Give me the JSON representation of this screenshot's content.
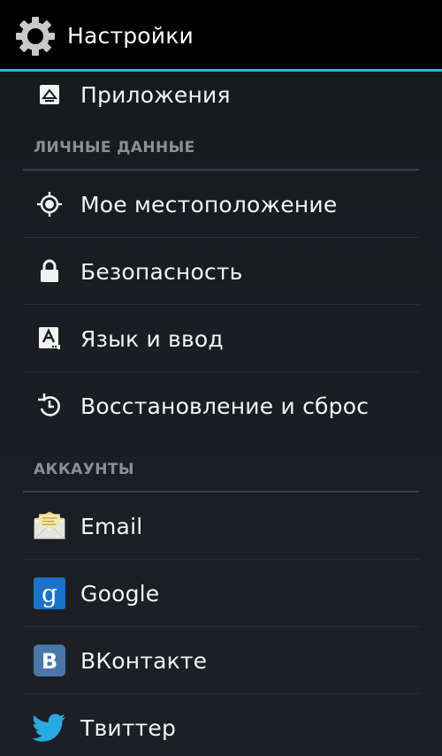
{
  "action_bar": {
    "title": "Настройки",
    "icon": "gear-icon",
    "divider_color": "#33b5e5"
  },
  "list": {
    "apps_item": {
      "label": "Приложения",
      "icon": "apps-icon"
    },
    "personal_header": "ЛИЧНЫЕ ДАННЫЕ",
    "personal_items": [
      {
        "label": "Мое местоположение",
        "icon": "location-icon"
      },
      {
        "label": "Безопасность",
        "icon": "lock-icon"
      },
      {
        "label": "Язык и ввод",
        "icon": "keyboard-language-icon"
      },
      {
        "label": "Восстановление и сброс",
        "icon": "backup-restore-icon"
      }
    ],
    "accounts_header": "АККАУНТЫ",
    "accounts_items": [
      {
        "label": "Email",
        "icon": "email-envelope-icon",
        "color": "#e9d27a"
      },
      {
        "label": "Google",
        "icon": "google-g-icon",
        "color": "#1a73c9"
      },
      {
        "label": "ВКонтакте",
        "icon": "vk-icon",
        "color": "#4a76a8"
      },
      {
        "label": "Твиттер",
        "icon": "twitter-bird-icon",
        "color": "#29a9e1"
      }
    ]
  }
}
